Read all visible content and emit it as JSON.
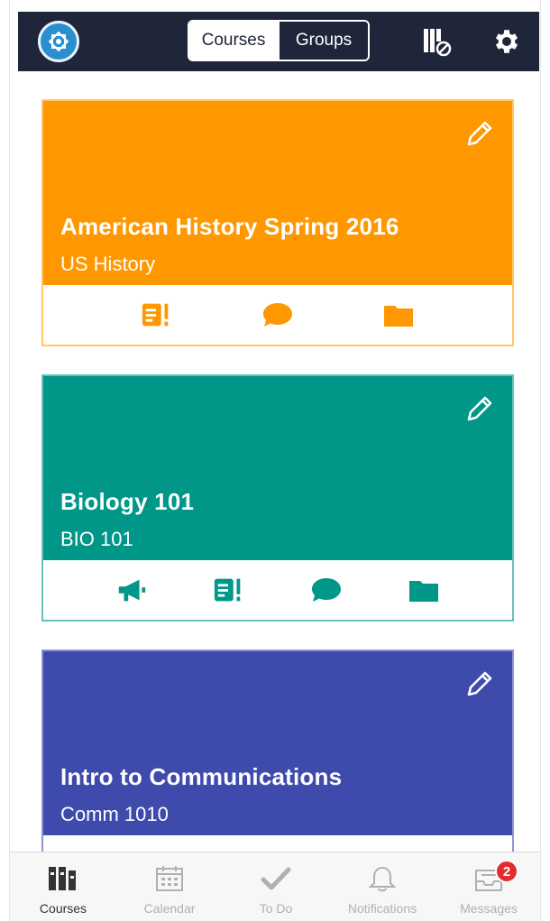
{
  "colors": {
    "nav_bg": "#20263a",
    "orange": "#ff9800",
    "teal": "#009688",
    "indigo": "#3f4aad",
    "inactive_tab": "#b0b0b0",
    "badge": "#e12d2d"
  },
  "header": {
    "segments": [
      {
        "label": "Courses",
        "active": true
      },
      {
        "label": "Groups",
        "active": false
      }
    ],
    "icons": [
      "app-logo-icon",
      "sort-cards-icon",
      "gear-icon"
    ]
  },
  "courses": [
    {
      "title": "American History Spring 2016",
      "code": "US History",
      "color": "#ff9800",
      "actions": [
        "assignments-icon",
        "discussions-icon",
        "files-icon"
      ]
    },
    {
      "title": "Biology 101",
      "code": "BIO 101",
      "color": "#009688",
      "actions": [
        "announcements-icon",
        "assignments-icon",
        "discussions-icon",
        "files-icon"
      ]
    },
    {
      "title": "Intro to Communications",
      "code": "Comm 1010",
      "color": "#3f4aad",
      "actions": []
    }
  ],
  "tabbar": {
    "tabs": [
      {
        "label": "Courses",
        "icon": "courses-icon",
        "active": true
      },
      {
        "label": "Calendar",
        "icon": "calendar-icon",
        "active": false
      },
      {
        "label": "To Do",
        "icon": "checkmark-icon",
        "active": false
      },
      {
        "label": "Notifications",
        "icon": "bell-icon",
        "active": false
      },
      {
        "label": "Messages",
        "icon": "inbox-icon",
        "active": false,
        "badge": "2"
      }
    ]
  }
}
